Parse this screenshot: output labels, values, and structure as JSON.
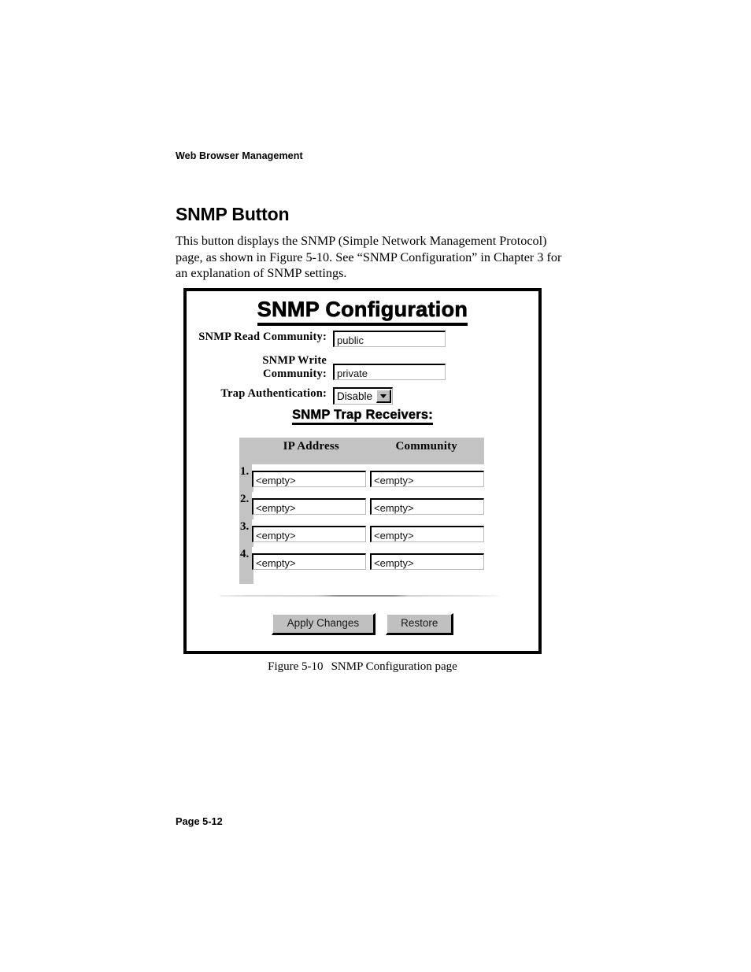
{
  "document": {
    "running_head": "Web Browser Management",
    "section_title": "SNMP Button",
    "body_text": "This button displays the SNMP (Simple Network Management Protocol) page, as shown in Figure 5-10. See “SNMP Configuration” in Chapter 3 for an explanation of SNMP settings.",
    "figure_caption_number": "Figure 5-10",
    "figure_caption_text": "SNMP Configuration page",
    "page_footer": "Page 5-12"
  },
  "screenshot": {
    "title": "SNMP Configuration",
    "form": {
      "read_community": {
        "label": "SNMP Read Community:",
        "value": "public"
      },
      "write_community": {
        "label_line1": "SNMP Write",
        "label_line2": "Community:",
        "value": "private"
      },
      "trap_authentication": {
        "label": "Trap Authentication:",
        "value": "Disable",
        "icon": "chevron-down-icon"
      }
    },
    "trap_receivers": {
      "heading": "SNMP Trap Receivers:",
      "columns": [
        "IP Address",
        "Community"
      ],
      "rows": [
        {
          "number": "1.",
          "ip_address": "<empty>",
          "community": "<empty>"
        },
        {
          "number": "2.",
          "ip_address": "<empty>",
          "community": "<empty>"
        },
        {
          "number": "3.",
          "ip_address": "<empty>",
          "community": "<empty>"
        },
        {
          "number": "4.",
          "ip_address": "<empty>",
          "community": "<empty>"
        }
      ]
    },
    "buttons": {
      "apply": "Apply Changes",
      "restore": "Restore"
    },
    "colors": {
      "table_header_gray": "#c3c3c3",
      "button_face": "#c0c0c0",
      "frame_border": "#000000"
    }
  }
}
